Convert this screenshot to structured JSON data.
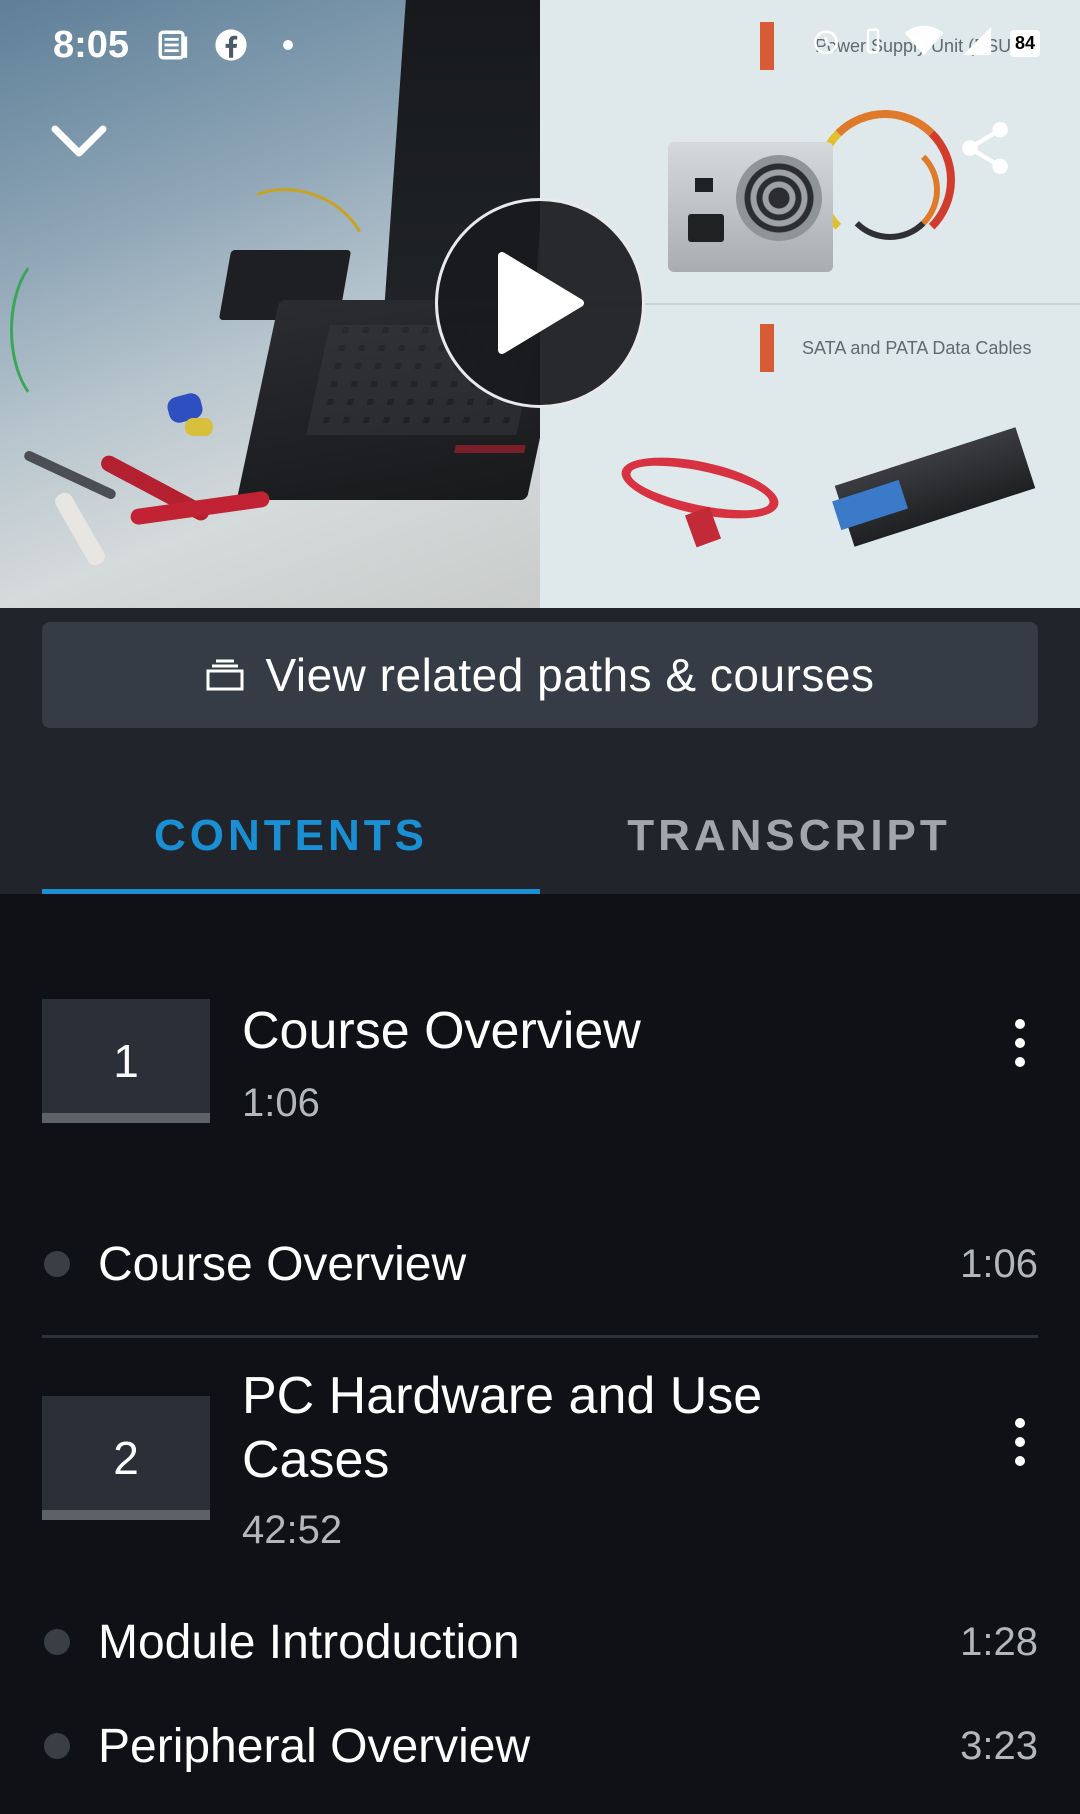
{
  "status_bar": {
    "time": "8:05",
    "battery": "84",
    "icons": [
      "news-icon",
      "facebook-icon",
      "dot-icon",
      "alarm-icon",
      "vibrate-icon",
      "wifi-icon",
      "signal-icon",
      "battery-icon"
    ]
  },
  "video": {
    "slide_labels": {
      "psu": "Power Supply Unit (PSU)",
      "cables": "SATA and PATA Data Cables"
    },
    "controls": [
      "chevron-down-icon",
      "share-icon",
      "play-icon"
    ]
  },
  "related": {
    "label": "View related paths & courses",
    "icon": "stack-icon"
  },
  "tabs": [
    {
      "label": "CONTENTS",
      "active": true
    },
    {
      "label": "TRANSCRIPT",
      "active": false
    }
  ],
  "modules": [
    {
      "number": "1",
      "title": "Course Overview",
      "duration": "1:06",
      "clips": [
        {
          "title": "Course Overview",
          "duration": "1:06"
        }
      ]
    },
    {
      "number": "2",
      "title": "PC Hardware and Use Cases",
      "duration": "42:52",
      "clips": [
        {
          "title": "Module Introduction",
          "duration": "1:28"
        },
        {
          "title": "Peripheral Overview",
          "duration": "3:23"
        }
      ]
    }
  ],
  "colors": {
    "accent": "#1a8fd4",
    "panel": "#21252b",
    "list_bg": "#0f1117",
    "button_bg": "#363c45",
    "slide_marker": "#d65b36"
  }
}
